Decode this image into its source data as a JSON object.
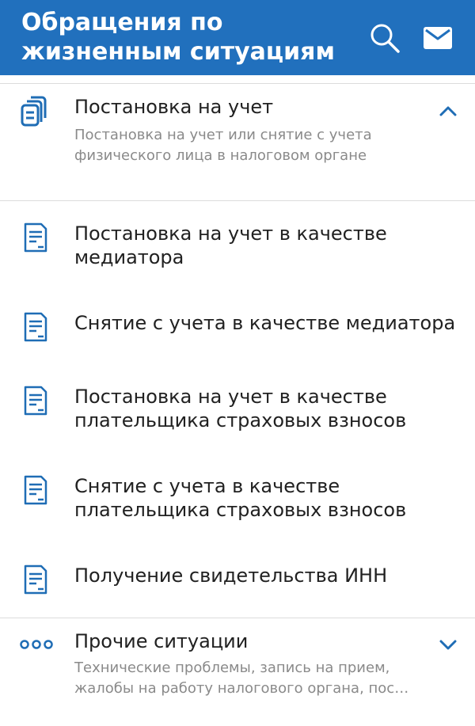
{
  "appbar": {
    "title_line1": "Обращения по",
    "title_line2": "жизненным ситуациям",
    "search_icon": "search-icon",
    "mail_icon": "mail-icon"
  },
  "colors": {
    "brand": "#2170bd",
    "text_primary": "#212121",
    "text_secondary": "#8a8a8a",
    "icon_blue": "#1f6db5"
  },
  "sections": [
    {
      "title": "Постановка на учет",
      "description": "Постановка на учет или снятие с учета физического лица в налоговом органе",
      "icon": "documents-icon",
      "expanded": true,
      "items": [
        {
          "label": "Постановка на учет в качестве медиатора",
          "icon": "document-icon"
        },
        {
          "label": "Снятие с учета в качестве медиатора",
          "icon": "document-icon"
        },
        {
          "label": "Постановка на учет в качестве плательщика страховых взносов",
          "icon": "document-icon"
        },
        {
          "label": "Снятие с учета в качестве плательщика страховых взносов",
          "icon": "document-icon"
        },
        {
          "label": "Получение свидетельства ИНН",
          "icon": "document-icon"
        }
      ]
    },
    {
      "title": "Прочие ситуации",
      "description": "Технические проблемы, запись на прием, жалобы на работу налогового органа, пос…",
      "icon": "more-dots-icon",
      "expanded": false
    }
  ]
}
